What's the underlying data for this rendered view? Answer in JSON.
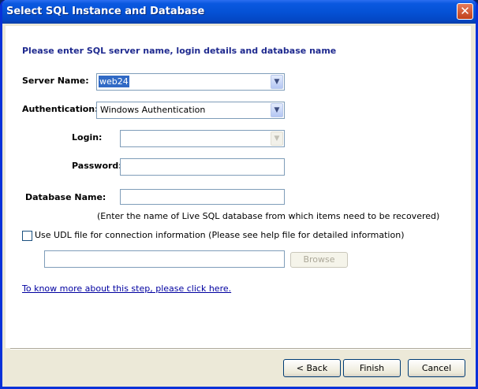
{
  "window": {
    "title": "Select SQL Instance and Database",
    "close_glyph": "✕"
  },
  "heading": "Please enter SQL server name, login details and database name",
  "server": {
    "label": "Server Name:",
    "value": "web24"
  },
  "auth": {
    "label": "Authentication:",
    "value": "Windows Authentication"
  },
  "login": {
    "label": "Login:",
    "value": ""
  },
  "password": {
    "label": "Password:",
    "value": ""
  },
  "database": {
    "label": "Database Name:",
    "value": "",
    "note": "(Enter the name of Live SQL database from which items need to be recovered)"
  },
  "udl": {
    "checked": false,
    "label": "Use UDL file for connection information (Please see help file for detailed information)",
    "path": "",
    "browse_label": "Browse"
  },
  "help_link": "To know more about this step, please click here.",
  "footer": {
    "back_label": "< Back",
    "finish_label": "Finish",
    "cancel_label": "Cancel"
  },
  "icons": {
    "dropdown": "chevron-down-icon",
    "close": "close-icon"
  }
}
